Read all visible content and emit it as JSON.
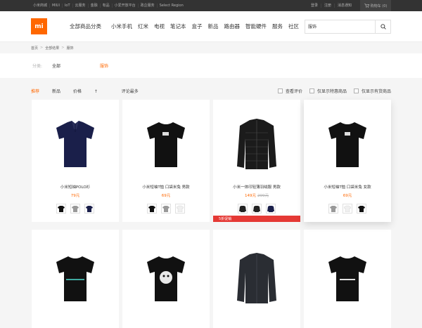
{
  "topbar": {
    "links": [
      "小米商城",
      "MIUI",
      "IoT",
      "云服务",
      "金融",
      "有品",
      "小爱开放平台",
      "政企服务",
      "Select Region"
    ],
    "account": [
      "登录",
      "注册",
      "消息通知"
    ],
    "cart": "购物车 (0)"
  },
  "header": {
    "logo": "mi",
    "nav": [
      "全部商品分类",
      "小米手机",
      "红米",
      "电视",
      "笔记本",
      "盒子",
      "新品",
      "路由器",
      "智能硬件",
      "服务",
      "社区"
    ],
    "search_value": "服饰"
  },
  "breadcrumb": [
    "首页",
    "全部结果",
    "服饰"
  ],
  "filter": {
    "label": "分类:",
    "all": "全部",
    "active": "服饰"
  },
  "sort": {
    "options": [
      "推荐",
      "新品",
      "价格",
      "评论最多"
    ],
    "price_arrow": "↑",
    "checks": [
      "查看评价",
      "仅显示特惠商品",
      "仅显示有货商品"
    ]
  },
  "products": [
    {
      "name": "小米短袖POLO衫",
      "price": "79元",
      "old_price": "",
      "color": "#1a1f4a",
      "thumbs": [
        "#111",
        "#999",
        "#1a1f4a"
      ]
    },
    {
      "name": "小米短袖T恤 口袋米兔 男款",
      "price": "69元",
      "old_price": "",
      "color": "#111111",
      "thumbs": [
        "#111",
        "#999",
        "#f0f0f0"
      ]
    },
    {
      "name": "小米一体印轻薄羽绒服 男款",
      "price": "149元",
      "old_price": "299元",
      "color": "#1b1b1b",
      "thumbs": [
        "#222",
        "#222",
        "#222"
      ],
      "promo": "5折促销"
    },
    {
      "name": "小米短袖T恤 口袋米兔 女款",
      "price": "69元",
      "old_price": "",
      "color": "#111111",
      "thumbs": [
        "#999",
        "#f0f0f0",
        "#111"
      ]
    }
  ],
  "products_row2": [
    {
      "color": "#111111"
    },
    {
      "color": "#111111"
    },
    {
      "color": "#2a2d33"
    },
    {
      "color": "#111111"
    }
  ]
}
